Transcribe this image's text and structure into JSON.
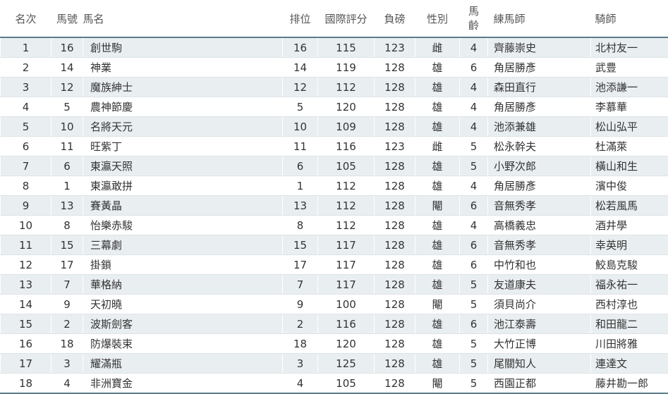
{
  "columns": {
    "rank": "名次",
    "number": "馬號",
    "horse": "馬名",
    "draw": "排位",
    "rating": "國際評分",
    "weight": "負磅",
    "sex": "性別",
    "age_top": "馬",
    "age_bottom": "齡",
    "trainer": "練馬師",
    "jockey": "騎師"
  },
  "rows": [
    {
      "rank": "1",
      "number": "16",
      "horse": "創世駒",
      "draw": "16",
      "rating": "115",
      "weight": "123",
      "sex": "雌",
      "age": "4",
      "trainer": "齊藤崇史",
      "jockey": "北村友一"
    },
    {
      "rank": "2",
      "number": "14",
      "horse": "神業",
      "draw": "14",
      "rating": "119",
      "weight": "128",
      "sex": "雄",
      "age": "6",
      "trainer": "角居勝彥",
      "jockey": "武豊"
    },
    {
      "rank": "3",
      "number": "12",
      "horse": "魔族紳士",
      "draw": "12",
      "rating": "112",
      "weight": "128",
      "sex": "雄",
      "age": "4",
      "trainer": "森田直行",
      "jockey": "池添謙一"
    },
    {
      "rank": "4",
      "number": "5",
      "horse": "農神節慶",
      "draw": "5",
      "rating": "120",
      "weight": "128",
      "sex": "雄",
      "age": "4",
      "trainer": "角居勝彥",
      "jockey": "李慕華"
    },
    {
      "rank": "5",
      "number": "10",
      "horse": "名將天元",
      "draw": "10",
      "rating": "109",
      "weight": "128",
      "sex": "雄",
      "age": "4",
      "trainer": "池添兼雄",
      "jockey": "松山弘平"
    },
    {
      "rank": "6",
      "number": "11",
      "horse": "旺紫丁",
      "draw": "11",
      "rating": "116",
      "weight": "123",
      "sex": "雌",
      "age": "5",
      "trainer": "松永幹夫",
      "jockey": "杜滿萊"
    },
    {
      "rank": "7",
      "number": "6",
      "horse": "東瀛天照",
      "draw": "6",
      "rating": "105",
      "weight": "128",
      "sex": "雄",
      "age": "5",
      "trainer": "小野次郎",
      "jockey": "橫山和生"
    },
    {
      "rank": "8",
      "number": "1",
      "horse": "東瀛敢拼",
      "draw": "1",
      "rating": "112",
      "weight": "128",
      "sex": "雄",
      "age": "4",
      "trainer": "角居勝彥",
      "jockey": "濱中俊"
    },
    {
      "rank": "9",
      "number": "13",
      "horse": "賽黃晶",
      "draw": "13",
      "rating": "112",
      "weight": "128",
      "sex": "閹",
      "age": "6",
      "trainer": "音無秀孝",
      "jockey": "松若風馬"
    },
    {
      "rank": "10",
      "number": "8",
      "horse": "怡樂赤駿",
      "draw": "8",
      "rating": "112",
      "weight": "128",
      "sex": "雄",
      "age": "4",
      "trainer": "高橋義忠",
      "jockey": "酒井學"
    },
    {
      "rank": "11",
      "number": "15",
      "horse": "三幕劇",
      "draw": "15",
      "rating": "117",
      "weight": "128",
      "sex": "雄",
      "age": "6",
      "trainer": "音無秀孝",
      "jockey": "幸英明"
    },
    {
      "rank": "12",
      "number": "17",
      "horse": "掛鎖",
      "draw": "17",
      "rating": "117",
      "weight": "128",
      "sex": "雄",
      "age": "6",
      "trainer": "中竹和也",
      "jockey": "鮫島克駿"
    },
    {
      "rank": "13",
      "number": "7",
      "horse": "華格納",
      "draw": "7",
      "rating": "117",
      "weight": "128",
      "sex": "雄",
      "age": "5",
      "trainer": "友道康夫",
      "jockey": "福永祐一"
    },
    {
      "rank": "14",
      "number": "9",
      "horse": "天初曉",
      "draw": "9",
      "rating": "100",
      "weight": "128",
      "sex": "閹",
      "age": "5",
      "trainer": "須貝尚介",
      "jockey": "西村淳也"
    },
    {
      "rank": "15",
      "number": "2",
      "horse": "波斯劍客",
      "draw": "2",
      "rating": "116",
      "weight": "128",
      "sex": "雄",
      "age": "6",
      "trainer": "池江泰壽",
      "jockey": "和田龍二"
    },
    {
      "rank": "16",
      "number": "18",
      "horse": "防爆裝束",
      "draw": "18",
      "rating": "120",
      "weight": "128",
      "sex": "雄",
      "age": "5",
      "trainer": "大竹正博",
      "jockey": "川田將雅"
    },
    {
      "rank": "17",
      "number": "3",
      "horse": "耀滿瓶",
      "draw": "3",
      "rating": "125",
      "weight": "128",
      "sex": "雄",
      "age": "5",
      "trainer": "尾關知人",
      "jockey": "連達文"
    },
    {
      "rank": "18",
      "number": "4",
      "horse": "非洲寶金",
      "draw": "4",
      "rating": "105",
      "weight": "128",
      "sex": "閹",
      "age": "5",
      "trainer": "西園正都",
      "jockey": "藤井勘一郎"
    }
  ]
}
